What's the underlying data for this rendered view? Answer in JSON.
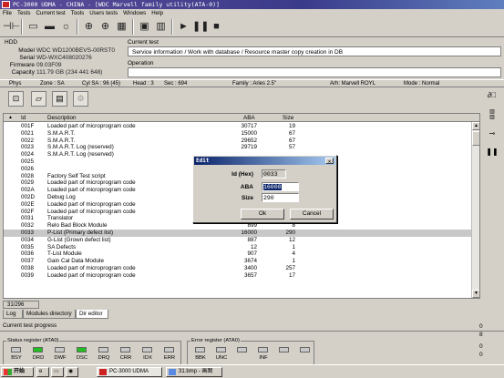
{
  "window": {
    "title": "PC-3000 UDMA - CHINA - [WDC Marvell family utility(ATA-0)]"
  },
  "menu": [
    "File",
    "Tests",
    "Current test",
    "Tools",
    "Users tests",
    "Windows",
    "Help"
  ],
  "hdd": {
    "section_label": "HDD",
    "fields": [
      {
        "label": "Model",
        "value": "WDC WD1200BEVS-00RST0"
      },
      {
        "label": "Serial",
        "value": "WD-WXC408020276"
      },
      {
        "label": "Firmware",
        "value": "09.03F09"
      },
      {
        "label": "Capacity",
        "value": "111.79 GB (234 441 648)"
      }
    ]
  },
  "current_test": {
    "label": "Current test",
    "value": "Service information / Work with database / Resource master copy creation in DB"
  },
  "operation": {
    "label": "Operation",
    "value": ""
  },
  "status_strip": {
    "phys": "Phys",
    "zone": "Zone : SA",
    "cyl": "Cyl SA : 96 (45)",
    "head": "Head : 3",
    "sec": "Sec : 694",
    "family": "Family : Aries 2.5\"",
    "arh": "Arh: Marvell ROYL",
    "mode": "Mode : Normal"
  },
  "table": {
    "columns": [
      "Id",
      "Description",
      "ABA",
      "Size"
    ],
    "rows": [
      {
        "id": "001F",
        "desc": "Loaded part of microprogram code",
        "aba": "30717",
        "size": "19"
      },
      {
        "id": "0021",
        "desc": "S.M.A.R.T.",
        "aba": "15000",
        "size": "67"
      },
      {
        "id": "0022",
        "desc": "S.M.A.R.T.",
        "aba": "29652",
        "size": "67"
      },
      {
        "id": "0023",
        "desc": "S.M.A.R.T. Log (reserved)",
        "aba": "29719",
        "size": "57"
      },
      {
        "id": "0024",
        "desc": "S.M.A.R.T. Log (reserved)",
        "aba": "",
        "size": ""
      },
      {
        "id": "0025",
        "desc": "",
        "aba": "",
        "size": ""
      },
      {
        "id": "0026",
        "desc": "",
        "aba": "",
        "size": ""
      },
      {
        "id": "0028",
        "desc": "Factory Self Test script",
        "aba": "",
        "size": ""
      },
      {
        "id": "0029",
        "desc": "Loaded part of microprogram code",
        "aba": "",
        "size": ""
      },
      {
        "id": "002A",
        "desc": "Loaded part of microprogram code",
        "aba": "",
        "size": ""
      },
      {
        "id": "002D",
        "desc": "Debug Log",
        "aba": "",
        "size": ""
      },
      {
        "id": "002E",
        "desc": "Loaded part of microprogram code",
        "aba": "",
        "size": ""
      },
      {
        "id": "002F",
        "desc": "Loaded part of microprogram code",
        "aba": "23070",
        "size": ""
      },
      {
        "id": "0031",
        "desc": "Translator",
        "aba": "707",
        "size": "176"
      },
      {
        "id": "0032",
        "desc": "Relo Bad Block Module",
        "aba": "899",
        "size": "8"
      },
      {
        "id": "0033",
        "desc": "P-List (Primary defect list)",
        "aba": "16000",
        "size": "290"
      },
      {
        "id": "0034",
        "desc": "G-List (Grown defect list)",
        "aba": "887",
        "size": "12"
      },
      {
        "id": "0035",
        "desc": "SA Defects",
        "aba": "12",
        "size": "1"
      },
      {
        "id": "0036",
        "desc": "T-List Module",
        "aba": "907",
        "size": "4"
      },
      {
        "id": "0037",
        "desc": "Gain Cal Data Module",
        "aba": "3674",
        "size": "1"
      },
      {
        "id": "0038",
        "desc": "Loaded part of microprogram code",
        "aba": "3400",
        "size": "257"
      },
      {
        "id": "0039",
        "desc": "Loaded part of microprogram code",
        "aba": "3657",
        "size": "17"
      }
    ],
    "selected_row": 15,
    "counter": "31/296"
  },
  "tabs": [
    "Log",
    "Modules directory",
    "Dir editor"
  ],
  "active_tab": 2,
  "progress_label": "Current test progress",
  "status_register": {
    "title": "Status register (ATA0)",
    "leds": [
      {
        "name": "BSY",
        "color": "#c8c8c8"
      },
      {
        "name": "DRD",
        "color": "#21c021"
      },
      {
        "name": "DWF",
        "color": "#c8c8c8"
      },
      {
        "name": "DSC",
        "color": "#21c021"
      },
      {
        "name": "DRQ",
        "color": "#c8c8c8"
      },
      {
        "name": "CRR",
        "color": "#c8c8c8"
      },
      {
        "name": "IDX",
        "color": "#c8c8c8"
      },
      {
        "name": "ERR",
        "color": "#c8c8c8"
      }
    ]
  },
  "error_register": {
    "title": "Error register (ATA0)",
    "leds": [
      {
        "name": "BBK",
        "color": "#c8c8c8"
      },
      {
        "name": "UNC",
        "color": "#c8c8c8"
      },
      {
        "name": "",
        "color": "#c8c8c8"
      },
      {
        "name": "INF",
        "color": "#c8c8c8"
      },
      {
        "name": "",
        "color": "#c8c8c8"
      },
      {
        "name": "",
        "color": "#c8c8c8"
      }
    ]
  },
  "right_readouts": [
    "0",
    "8",
    "0",
    "0"
  ],
  "dialog": {
    "title": "Edit",
    "id_label": "Id (Hex)",
    "id_value": "0033",
    "aba_label": "ABA",
    "aba_value": "16000",
    "size_label": "Size",
    "size_value": "290",
    "ok": "Ok",
    "cancel": "Cancel"
  },
  "taskbar": {
    "start": "开始",
    "items": [
      "PC-3000 UDMA",
      "31.bmp - 画图"
    ]
  }
}
